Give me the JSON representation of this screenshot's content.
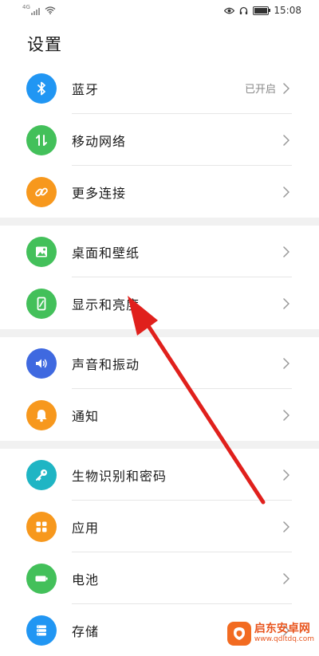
{
  "status_bar": {
    "signal_text": "4G",
    "time": "15:08",
    "battery_level": 1.0
  },
  "page": {
    "title": "设置"
  },
  "groups": [
    [
      {
        "key": "bluetooth",
        "label": "蓝牙",
        "value": "已开启",
        "icon": "bluetooth-icon",
        "color": "#2196f3"
      },
      {
        "key": "mobile-network",
        "label": "移动网络",
        "value": "",
        "icon": "mobile-data-icon",
        "color": "#43c05a"
      },
      {
        "key": "more-connections",
        "label": "更多连接",
        "value": "",
        "icon": "link-icon",
        "color": "#f7981d"
      }
    ],
    [
      {
        "key": "wallpaper",
        "label": "桌面和壁纸",
        "value": "",
        "icon": "picture-icon",
        "color": "#43c05a"
      },
      {
        "key": "display",
        "label": "显示和亮度",
        "value": "",
        "icon": "phone-brightness-icon",
        "color": "#43c05a"
      }
    ],
    [
      {
        "key": "sound",
        "label": "声音和振动",
        "value": "",
        "icon": "volume-icon",
        "color": "#3f69e0"
      },
      {
        "key": "notifications",
        "label": "通知",
        "value": "",
        "icon": "bell-icon",
        "color": "#f7981d"
      }
    ],
    [
      {
        "key": "biometrics",
        "label": "生物识别和密码",
        "value": "",
        "icon": "key-icon",
        "color": "#1fb5c4"
      },
      {
        "key": "apps",
        "label": "应用",
        "value": "",
        "icon": "apps-grid-icon",
        "color": "#f7981d"
      },
      {
        "key": "battery",
        "label": "电池",
        "value": "",
        "icon": "battery-icon",
        "color": "#43c05a"
      },
      {
        "key": "storage",
        "label": "存储",
        "value": "",
        "icon": "storage-icon",
        "color": "#2196f3"
      }
    ]
  ],
  "annotation": {
    "arrow_color": "#e0201c"
  },
  "watermark": {
    "name": "启东安卓网",
    "url": "www.qdltdq.com"
  }
}
